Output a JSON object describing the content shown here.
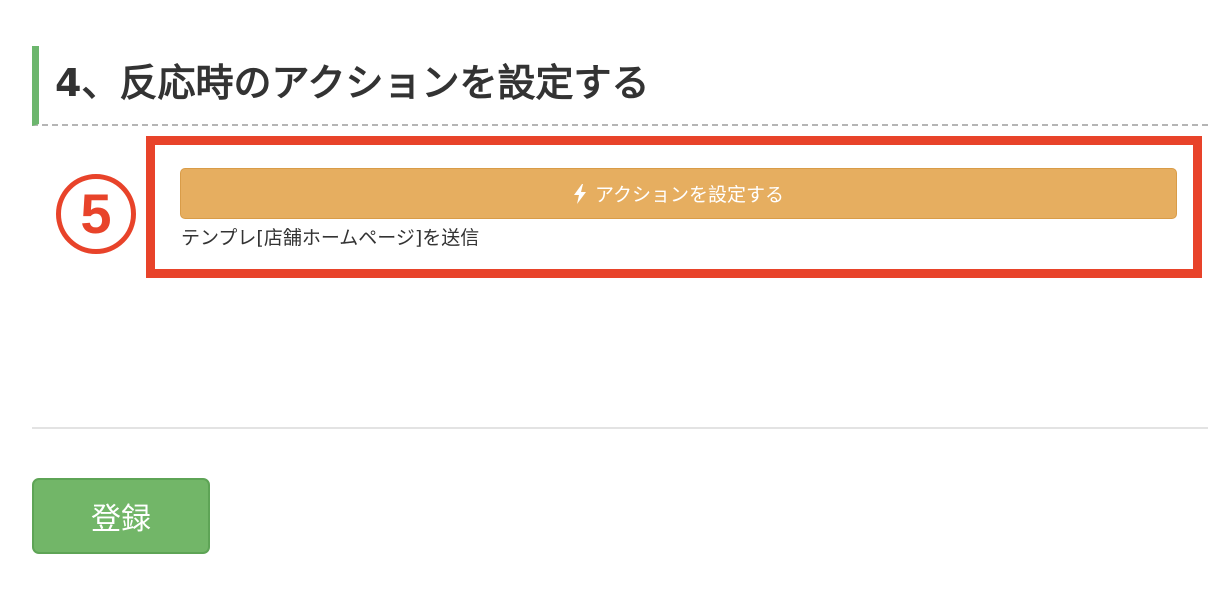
{
  "section": {
    "title": "4、反応時のアクションを設定する"
  },
  "annotation": {
    "step_number": "5",
    "highlight_color": "#e8432a"
  },
  "action": {
    "button_label": "アクションを設定する",
    "button_icon": "lightning-bolt-icon",
    "summary": "テンプレ[店舗ホームページ]を送信"
  },
  "form": {
    "submit_label": "登録"
  },
  "colors": {
    "section_accent": "#6cb66d",
    "action_button": "#e6ae60",
    "submit_button": "#72b668"
  }
}
